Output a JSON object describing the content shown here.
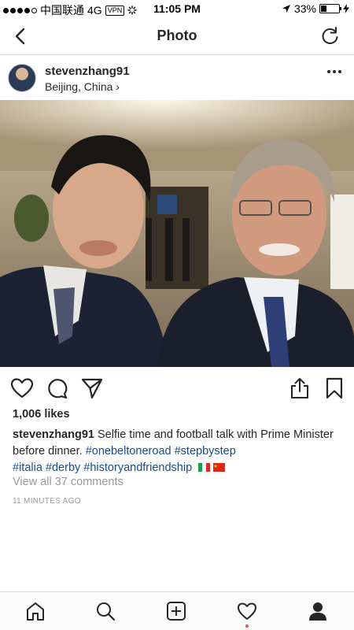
{
  "status_bar": {
    "carrier": "中国联通",
    "network": "4G",
    "vpn": "VPN",
    "time": "11:05 PM",
    "battery": "33%",
    "battery_level": 0.33,
    "signal_bars": 4,
    "icons": [
      "location-arrow-icon",
      "charging-bolt-icon"
    ]
  },
  "nav": {
    "title": "Photo",
    "back_icon": "chevron-left-icon",
    "refresh_icon": "refresh-icon"
  },
  "post": {
    "username": "stevenzhang91",
    "location": "Beijing, China ›",
    "more_icon": "more-horizontal-icon",
    "likes": "1,006 likes",
    "caption_user": "stevenzhang91",
    "caption_text": " Selfie time and football talk with Prime Minister before dinner. ",
    "tags_line1": [
      "#onebeltoneroad",
      "#stepbystep"
    ],
    "tags_line2": [
      "#italia",
      "#derby",
      "#historyandfriendship"
    ],
    "flags": [
      "italy-flag",
      "china-flag"
    ],
    "view_comments": "View all 37 comments",
    "time_ago": "11 MINUTES AGO"
  },
  "actions": [
    "heart-icon",
    "comment-icon",
    "share-direct-icon",
    "upload-share-icon",
    "bookmark-icon"
  ],
  "tab_bar": [
    "home-icon",
    "search-icon",
    "add-post-icon",
    "activity-heart-icon",
    "profile-icon"
  ],
  "colors": {
    "text": "#262626",
    "hashtag": "#1a4a8a",
    "muted": "#999999",
    "border": "#dbdbdb",
    "notification": "#ed4956"
  }
}
